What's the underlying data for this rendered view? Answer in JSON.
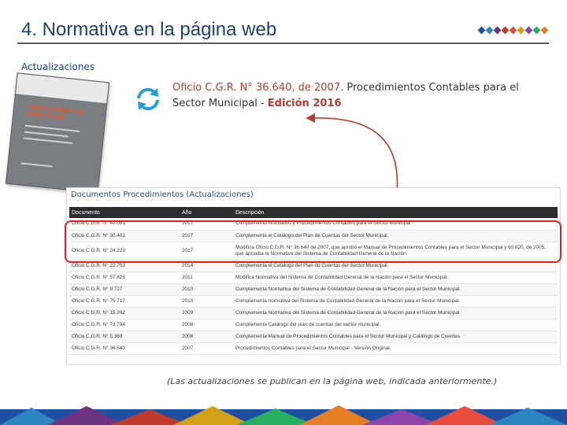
{
  "header": {
    "title": "4. Normativa en la página web"
  },
  "section": {
    "label": "Actualizaciones"
  },
  "book": {
    "title_line1": "PROCEDIMIENTOS",
    "title_line2": "CONTABLES"
  },
  "headline": {
    "reference": "Oficio C.G.R. N° 36.640, de 2007.",
    "description": "Procedimientos Contables para el Sector Municipal -",
    "edition": "Edición 2016"
  },
  "documents_table": {
    "heading": "Documentos Procedimientos (Actualizaciones)",
    "columns": [
      "Documento",
      "Año",
      "Descripción"
    ],
    "rows": [
      {
        "doc": "Oficio C.G.R. N° 40.091",
        "year": "2017",
        "desc": "Complemento Normativo y Procedimientos Contables para el Sector Municipal."
      },
      {
        "doc": "Oficio C.G.R. N° 30.401",
        "year": "2017",
        "desc": "Complementa el Catálogo del Plan de Cuentas del Sector Municipal."
      },
      {
        "doc": "Oficio C.G.R. N° 24.223",
        "year": "2017",
        "desc": "Modifica Oficio C.G.R. N° 36.640 de 2007, que aprobó el Manual de Procedimientos Contables para el Sector Municipal y 60.820, de 2005, que aprueba la Normativa del Sistema de Contabilidad General de la Nación."
      },
      {
        "doc": "Oficio C.G.R. N° 22.703",
        "year": "2014",
        "desc": "Complementa el Catálogo del Plan de Cuentas del Sector Municipal."
      },
      {
        "doc": "Oficio C.G.R. N° 57.825",
        "year": "2011",
        "desc": "Modifica Normativa del Sistema de Contabilidad General de la Nación para el Sector Municipal."
      },
      {
        "doc": "Oficio C.G.R. N° 9.727",
        "year": "2010",
        "desc": "Complementa Normativa del Sistema de Contabilidad General de la Nación para el Sector Municipal."
      },
      {
        "doc": "Oficio C.G.R. N° 75.717",
        "year": "2010",
        "desc": "Complementa normativa del Sistema de Contabilidad General de la Nación para el Sector Municipal."
      },
      {
        "doc": "Oficio C.G.R. N° 15.202",
        "year": "2009",
        "desc": "Complementa Normativa del Sistema de Contabilidad General de la Nación para el Sector Municipal."
      },
      {
        "doc": "Oficio C.G.R. N° 73.794",
        "year": "2008",
        "desc": "Complementa Catálogo del plan de cuentas del sector municipal."
      },
      {
        "doc": "Oficio C.G.R. N° 5.369",
        "year": "2008",
        "desc": "Complementa Manual de Procedimientos Contables para el Sector Municipal y Catálogo de Cuentas."
      },
      {
        "doc": "Oficio C.G.R. N° 36.640",
        "year": "2007",
        "desc": "Procedimientos Contables para el Sector Municipal - Versión Original."
      }
    ]
  },
  "caption": "(Las actualizaciones se publican en la página web, indicada anteriormente.)",
  "icons": {
    "refresh": "refresh-icon",
    "brand": "brand-dots-icon"
  },
  "colors": {
    "title": "#1f3f78",
    "accent_red": "#c0392b",
    "highlight": "#e02020",
    "refresh": "#2a9fd6"
  }
}
